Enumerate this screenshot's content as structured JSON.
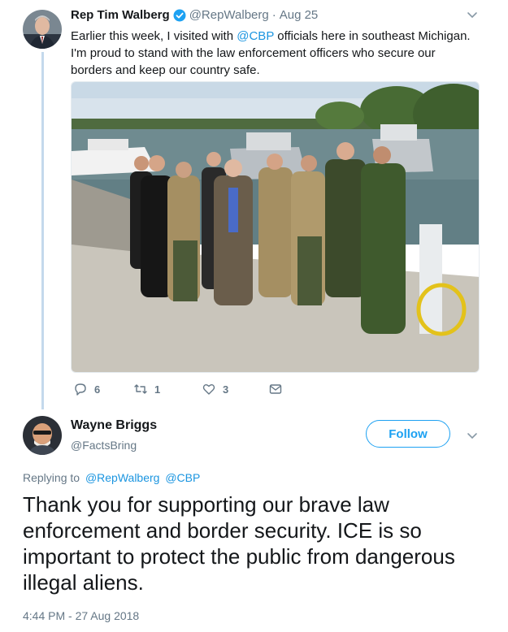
{
  "tweet": {
    "author_name": "Rep Tim Walberg",
    "handle": "@RepWalberg",
    "separator": "·",
    "date": "Aug 25",
    "text_part1": "Earlier this week, I visited with ",
    "mention": "@CBP",
    "text_part2": " officials here in southeast Michigan. I'm proud to stand with the law enforcement officers who secure our borders and keep our country safe.",
    "actions": {
      "replies": "6",
      "retweets": "1",
      "likes": "3"
    }
  },
  "reply": {
    "author_name": "Wayne Briggs",
    "handle": "@FactsBring",
    "follow_label": "Follow",
    "replying_to_label": "Replying to",
    "replying_to_1": "@RepWalberg",
    "replying_to_2": "@CBP",
    "text": "Thank you for supporting our brave law enforcement and border security. ICE is so important to protect the public from dangerous illegal aliens.",
    "timestamp": "4:44 PM - 27 Aug 2018"
  },
  "colors": {
    "accent": "#1da1f2",
    "link": "#1b95e0",
    "secondary_text": "#657786",
    "thread_line": "#c4d9ec"
  },
  "icons": [
    "verified-badge-icon",
    "chevron-down-icon",
    "reply-icon",
    "retweet-icon",
    "like-icon",
    "direct-message-icon"
  ]
}
